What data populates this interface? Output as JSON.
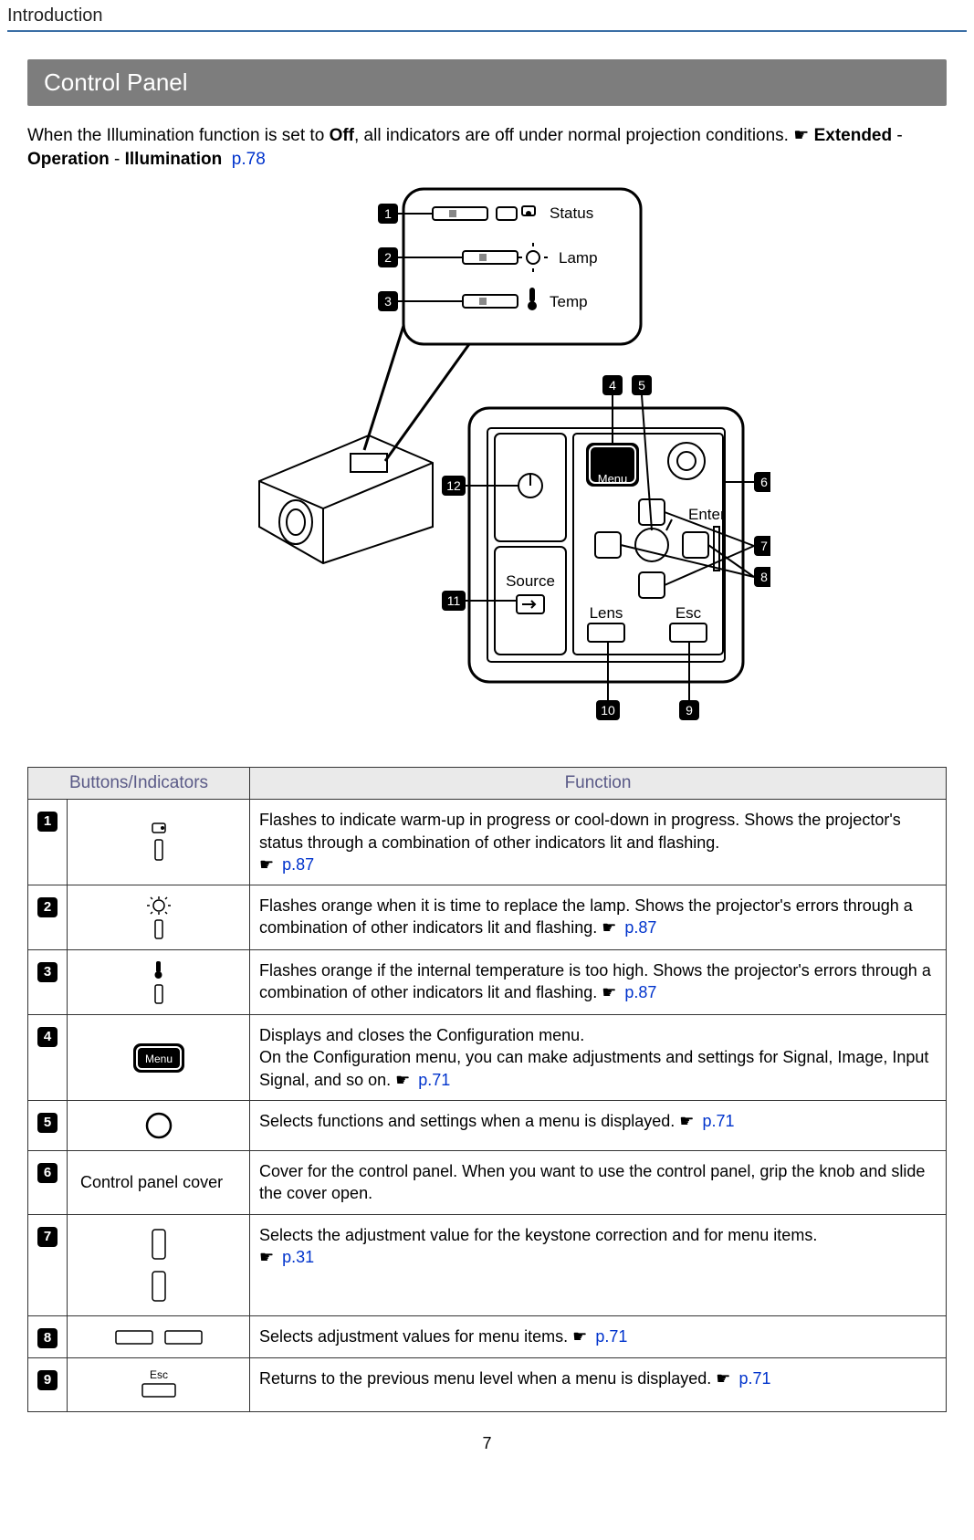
{
  "header": {
    "title": "Introduction"
  },
  "section": {
    "title": "Control Panel"
  },
  "intro": {
    "prefix": "When the Illumination function is set to ",
    "off": "Off",
    "mid": ", all indicators are off under normal projection conditions.",
    "b1": "Extended",
    "dash1": " - ",
    "b2": "Operation",
    "dash2": " - ",
    "b3": "Illumination",
    "link": "p.78"
  },
  "diagram": {
    "labels": {
      "status": "Status",
      "lamp": "Lamp",
      "temp": "Temp",
      "menu": "Menu",
      "enter": "Enter",
      "source": "Source",
      "lens": "Lens",
      "esc": "Esc"
    },
    "callouts": [
      "1",
      "2",
      "3",
      "4",
      "5",
      "6",
      "7",
      "8",
      "9",
      "10",
      "11",
      "12"
    ]
  },
  "table": {
    "head": {
      "col1": "Buttons/Indicators",
      "col2": "Function"
    },
    "rows": [
      {
        "num": "1",
        "label": "",
        "text": "Flashes to indicate warm-up in progress or cool-down in progress. Shows the projector's status through a combination of other indicators lit and flashing.",
        "link": "p.87"
      },
      {
        "num": "2",
        "label": "",
        "text": "Flashes orange when it is time to replace the lamp. Shows the projector's errors through a combination of other indicators lit and flashing.",
        "link": "p.87"
      },
      {
        "num": "3",
        "label": "",
        "text": "Flashes orange if the internal temperature is too high. Shows the projector's errors through a combination of other indicators lit and flashing.",
        "link": "p.87"
      },
      {
        "num": "4",
        "label": "",
        "text1": "Displays and closes the Configuration menu.",
        "text2": "On the Configuration menu, you can make adjustments and settings for Signal, Image, Input Signal, and so on.",
        "link": "p.71"
      },
      {
        "num": "5",
        "label": "",
        "text": "Selects functions and settings when a menu is displayed.",
        "link": "p.71"
      },
      {
        "num": "6",
        "label": "Control panel cover",
        "text": "Cover for the control panel. When you want to use the control panel, grip the knob and slide the cover open.",
        "link": ""
      },
      {
        "num": "7",
        "label": "",
        "text": "Selects the adjustment value for the keystone correction and for menu items.",
        "link": "p.31"
      },
      {
        "num": "8",
        "label": "",
        "text": "Selects adjustment values for menu items.",
        "link": "p.71"
      },
      {
        "num": "9",
        "label": "Esc",
        "text": "Returns to the previous menu level when a menu is displayed.",
        "link": "p.71"
      }
    ]
  },
  "page_number": "7"
}
